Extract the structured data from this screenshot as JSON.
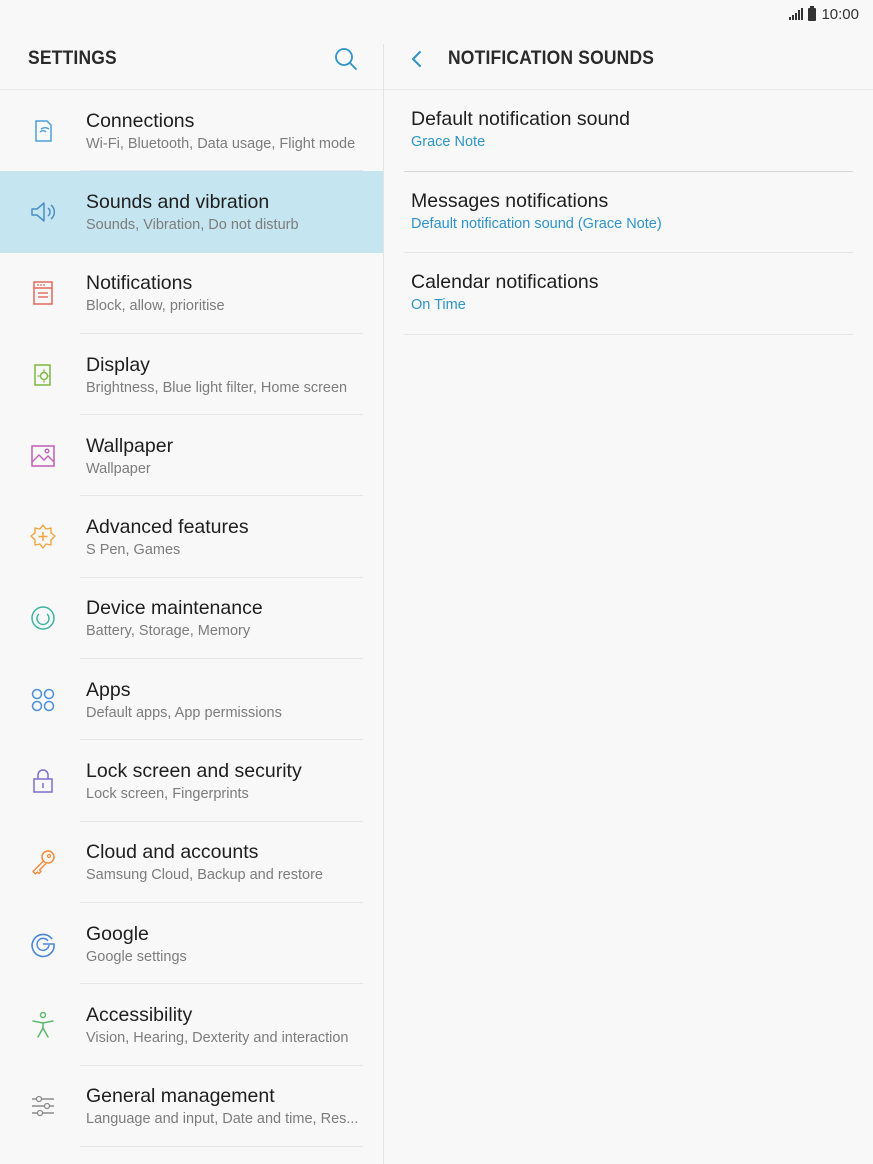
{
  "status_bar": {
    "time": "10:00",
    "icons": [
      "signal-icon",
      "battery-icon"
    ]
  },
  "left_pane": {
    "title": "SETTINGS",
    "search_icon": "search-icon",
    "items": [
      {
        "title": "Connections",
        "subtitle": "Wi-Fi, Bluetooth, Data usage, Flight mode",
        "icon": "connections-icon",
        "color": "#4a9fd8",
        "active": false
      },
      {
        "title": "Sounds and vibration",
        "subtitle": "Sounds, Vibration, Do not disturb",
        "icon": "speaker-icon",
        "color": "#4a8fc8",
        "active": true
      },
      {
        "title": "Notifications",
        "subtitle": "Block, allow, prioritise",
        "icon": "notifications-icon",
        "color": "#e06a5a",
        "active": false
      },
      {
        "title": "Display",
        "subtitle": "Brightness, Blue light filter, Home screen",
        "icon": "display-icon",
        "color": "#7cb83f",
        "active": false
      },
      {
        "title": "Wallpaper",
        "subtitle": "Wallpaper",
        "icon": "wallpaper-icon",
        "color": "#c25eb8",
        "active": false
      },
      {
        "title": "Advanced features",
        "subtitle": "S Pen, Games",
        "icon": "advanced-features-icon",
        "color": "#f0a43a",
        "active": false
      },
      {
        "title": "Device maintenance",
        "subtitle": "Battery, Storage, Memory",
        "icon": "device-maintenance-icon",
        "color": "#3bb5a0",
        "active": false
      },
      {
        "title": "Apps",
        "subtitle": "Default apps, App permissions",
        "icon": "apps-icon",
        "color": "#4a90d8",
        "active": false
      },
      {
        "title": "Lock screen and security",
        "subtitle": "Lock screen, Fingerprints",
        "icon": "lock-icon",
        "color": "#7a6fd0",
        "active": false
      },
      {
        "title": "Cloud and accounts",
        "subtitle": "Samsung Cloud, Backup and restore",
        "icon": "key-icon",
        "color": "#f08a3a",
        "active": false
      },
      {
        "title": "Google",
        "subtitle": "Google settings",
        "icon": "google-icon",
        "color": "#4a86d8",
        "active": false
      },
      {
        "title": "Accessibility",
        "subtitle": "Vision, Hearing, Dexterity and interaction",
        "icon": "accessibility-icon",
        "color": "#5cb86a",
        "active": false
      },
      {
        "title": "General management",
        "subtitle": "Language and input, Date and time, Res...",
        "icon": "sliders-icon",
        "color": "#8a8a8a",
        "active": false
      }
    ]
  },
  "right_pane": {
    "title": "NOTIFICATION SOUNDS",
    "back_icon": "back-arrow-icon",
    "items": [
      {
        "title": "Default notification sound",
        "value": "Grace Note"
      },
      {
        "title": "Messages notifications",
        "value": "Default notification sound (Grace Note)"
      },
      {
        "title": "Calendar notifications",
        "value": "On Time"
      }
    ]
  },
  "colors": {
    "accent": "#2e93c6",
    "active_row": "#c5e5f0",
    "background": "#f8f8f8"
  }
}
